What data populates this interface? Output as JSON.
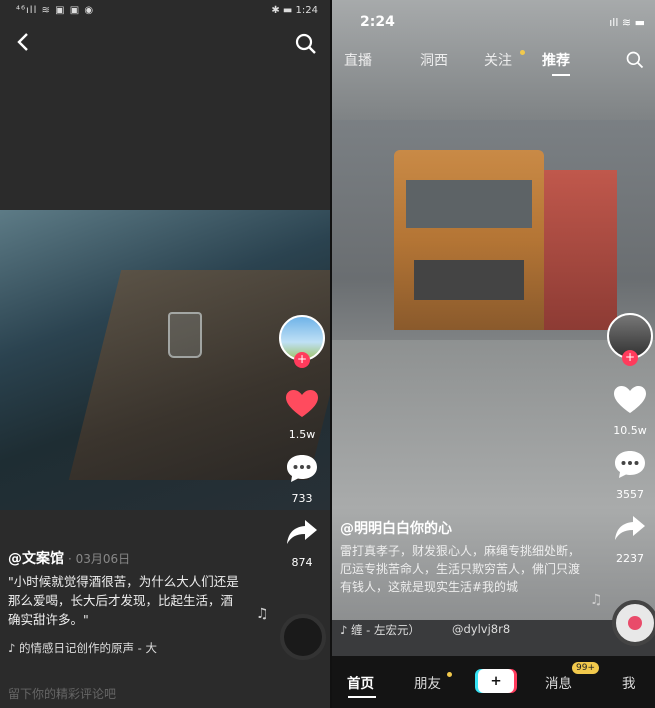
{
  "left": {
    "status_left": "⁴⁶ıll ≋ ▣ ▣ ◉",
    "status_right": "✱ ▬ 1:24",
    "author": "@文案馆",
    "date": "· 03月06日",
    "description": "\"小时候就觉得酒很苦，为什么大人们还是那么爱喝，长大后才发现，比起生活，酒确实甜许多。\"",
    "music": "♪ 的情感日记创作的原声 - 大",
    "comment_hint": "留下你的精彩评论吧",
    "likes": "1.5w",
    "comments": "733",
    "shares": "874"
  },
  "right": {
    "time": "2:24",
    "tabs": [
      "直播",
      "洞西",
      "关注",
      "推荐"
    ],
    "author": "@明明白白你的心",
    "description": "雷打真孝子，财发狠心人，麻绳专挑细处断，厄运专挑苦命人，生活只欺穷苦人，佛门只渡有钱人，这就是现实生活#我的城",
    "music": "♪ 缠 - 左宏元）",
    "music_id": "@dylvj8r8",
    "likes": "10.5w",
    "comments": "3557",
    "shares": "2237",
    "nav": {
      "home": "首页",
      "friends": "朋友",
      "plus": "+",
      "messages": "消息",
      "badge": "99+",
      "me": "我"
    }
  },
  "colors": {
    "like_red": "#ff4b5e",
    "accent_pink": "#ff3b5c",
    "accent_cyan": "#37e3f5",
    "badge_yellow": "#f2c94c"
  }
}
